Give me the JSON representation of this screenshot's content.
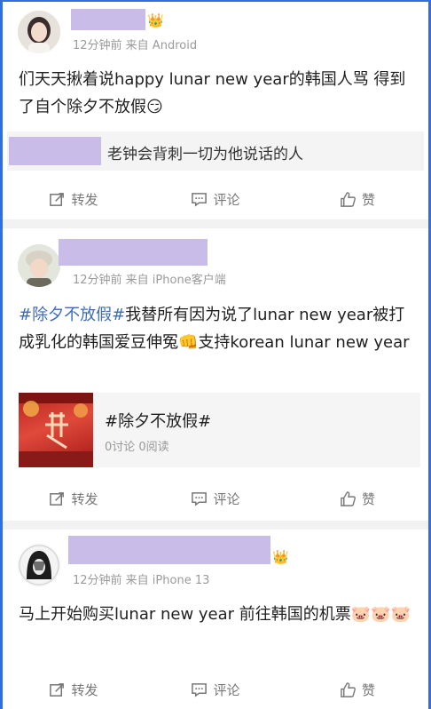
{
  "posts": [
    {
      "meta": "12分钟前  来自 Android",
      "text": "们天天揪着说happy lunar new year的韩国人骂 得到了自个除夕不放假😏",
      "quote_text": "老钟会背刺一切为他说话的人",
      "actions": {
        "repost": "转发",
        "comment": "评论",
        "like": "赞"
      }
    },
    {
      "meta": "12分钟前  来自 iPhone客户端",
      "hashtag": "#除夕不放假#",
      "text": "我替所有因为说了lunar new year被打成乳化的韩国爱豆伸冤👊支持korean lunar new year",
      "topic": {
        "title": "#除夕不放假#",
        "stats": "0讨论  0阅读"
      },
      "actions": {
        "repost": "转发",
        "comment": "评论",
        "like": "赞"
      }
    },
    {
      "meta": "12分钟前  来自 iPhone 13",
      "text": "马上开始购买lunar new year 前往韩国的机票🐷🐷🐷",
      "actions": {
        "repost": "转发",
        "comment": "评论",
        "like": "赞"
      }
    }
  ],
  "colors": {
    "accent": "#2f6fe0",
    "hashtag": "#3d6db5",
    "redaction": "#c9bce8"
  }
}
